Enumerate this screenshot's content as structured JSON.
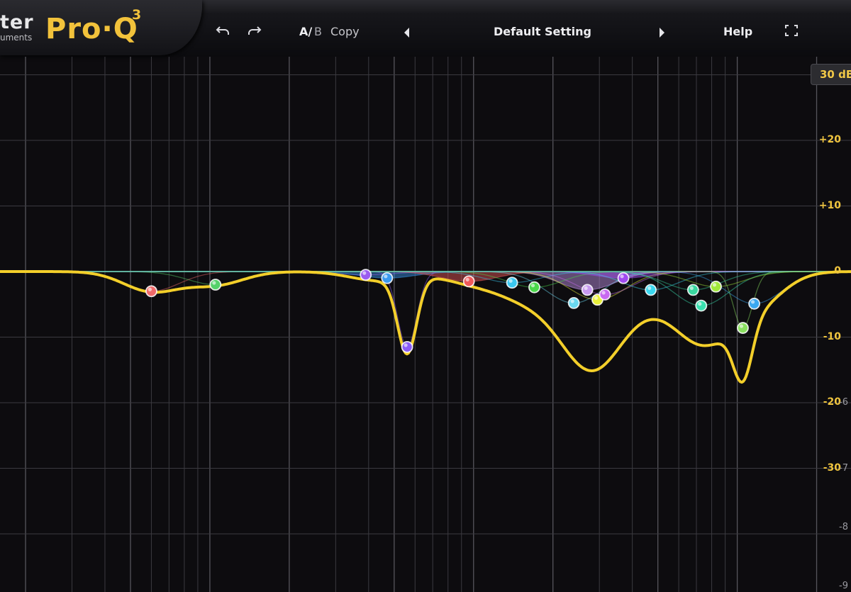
{
  "header": {
    "brand_top": "ter",
    "brand_bottom": "uments",
    "product": "Pro·Q",
    "product_sup": "3",
    "undo_icon": "undo-icon",
    "redo_icon": "redo-icon",
    "ab_a": "A/",
    "ab_b": "B",
    "copy": "Copy",
    "preset_name": "Default Setting",
    "help": "Help",
    "fullscreen_icon": "fullscreen-icon"
  },
  "graph": {
    "range_button": "30 dB",
    "db_scale": [
      {
        "text": "+20",
        "db": 20
      },
      {
        "text": "+10",
        "db": 10
      },
      {
        "text": "0",
        "db": 0
      },
      {
        "text": "-10",
        "db": -10
      },
      {
        "text": "-20",
        "db": -20
      },
      {
        "text": "-30",
        "db": -30
      }
    ],
    "analyzer_scale": [
      {
        "text": "-6",
        "db": -20
      },
      {
        "text": "-7",
        "db": -30
      },
      {
        "text": "-8",
        "db": -39
      },
      {
        "text": "-9",
        "db": -48
      }
    ],
    "colors": {
      "curve": "#f3cf2a",
      "grid": "#3b3a40",
      "grid_major": "#56555c",
      "label": "#f0c53f"
    },
    "bands": [
      {
        "freq": 60,
        "gain": -3,
        "color": "#f06a6a"
      },
      {
        "freq": 105,
        "gain": -2,
        "color": "#54d16a"
      },
      {
        "freq": 390,
        "gain": -0.5,
        "color": "#9a5cf0"
      },
      {
        "freq": 470,
        "gain": -1,
        "color": "#3a9af0",
        "fill": true
      },
      {
        "freq": 560,
        "gain": -11.5,
        "color": "#8a5cf5"
      },
      {
        "freq": 960,
        "gain": -1.5,
        "color": "#f05a5a",
        "fill": true
      },
      {
        "freq": 1400,
        "gain": -1.7,
        "color": "#3ac8f0"
      },
      {
        "freq": 1700,
        "gain": -2.4,
        "color": "#4ad84a"
      },
      {
        "freq": 2400,
        "gain": -4.8,
        "color": "#6ad8f0"
      },
      {
        "freq": 2700,
        "gain": -2.8,
        "color": "#c89af0",
        "fill": true
      },
      {
        "freq": 2950,
        "gain": -4.3,
        "color": "#e8f03a"
      },
      {
        "freq": 3150,
        "gain": -3.5,
        "color": "#c86af0"
      },
      {
        "freq": 3700,
        "gain": -1,
        "color": "#a04af0",
        "fill": true
      },
      {
        "freq": 4700,
        "gain": -2.8,
        "color": "#3ad8f0"
      },
      {
        "freq": 6800,
        "gain": -2.8,
        "color": "#3ad8a0"
      },
      {
        "freq": 7300,
        "gain": -5.2,
        "color": "#3ae0b0"
      },
      {
        "freq": 8300,
        "gain": -2.3,
        "color": "#a0e83a"
      },
      {
        "freq": 10500,
        "gain": -8.6,
        "color": "#8ae060"
      },
      {
        "freq": 11600,
        "gain": -4.9,
        "color": "#3aa8f0"
      }
    ]
  }
}
